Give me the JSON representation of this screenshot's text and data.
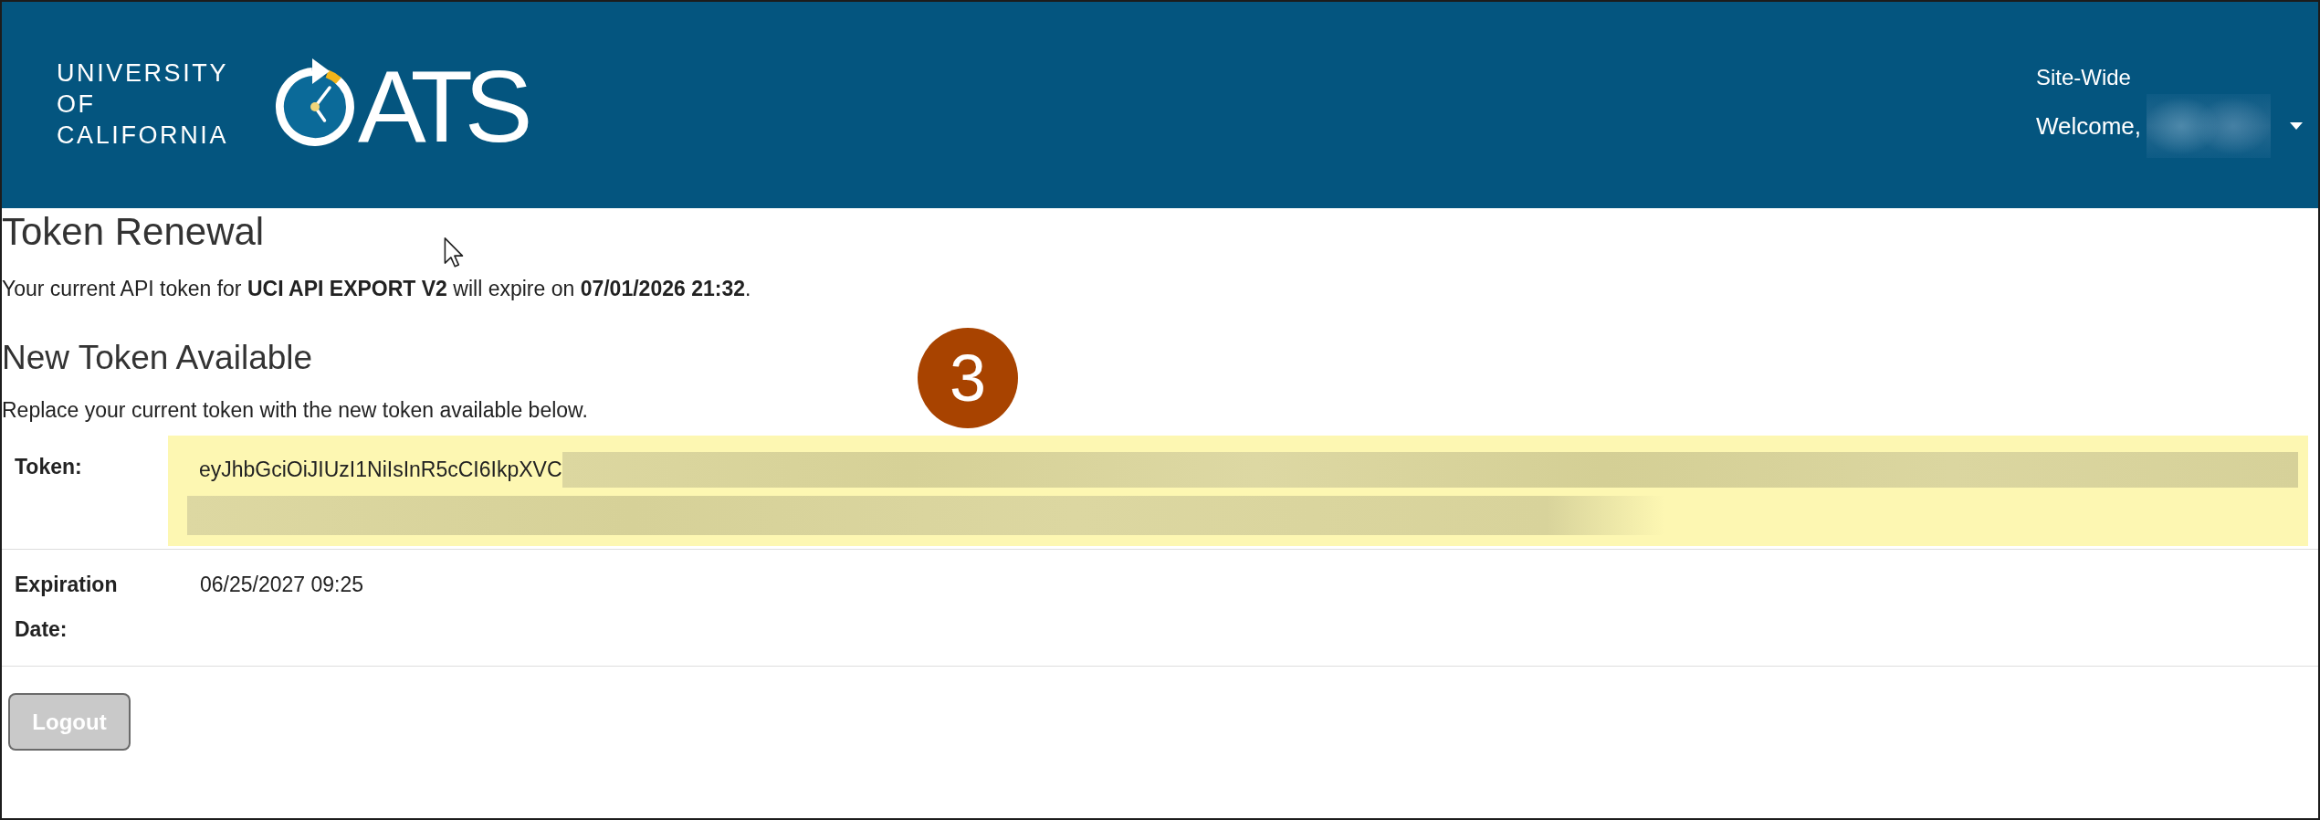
{
  "header": {
    "logo": {
      "org_name": "UNIVERSITY OF CALIFORNIA",
      "app_name": "ATS"
    },
    "scope_link": "Site-Wide",
    "user_menu": {
      "greeting": "Welcome,",
      "name_redacted": true
    }
  },
  "page": {
    "title": "Token Renewal",
    "notice": "Your current API token for **UCI API EXPORT V2** will expire on **07/01/2026 21:32**.",
    "section_title": "New Token Available",
    "section_text": "Replace your current token with the new token available below."
  },
  "token_details": [
    {
      "label": "Token:",
      "value": "eyJhbGciOiJIUzI1NiIsInR5cCI6IkpXVC",
      "highlighted": true,
      "redacted": true
    },
    {
      "label": "Expiration Date:",
      "value": "06/25/2027 09:25",
      "highlighted": false,
      "redacted": false
    }
  ],
  "buttons": [
    {
      "label": "Logout",
      "disabled": true
    }
  ],
  "step_marker": {
    "label": "3"
  }
}
